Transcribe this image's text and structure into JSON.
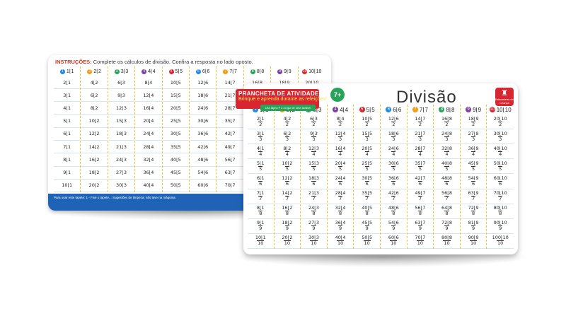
{
  "back_board": {
    "instructions_label": "INSTRUÇÕES:",
    "instructions_text": "Complete os cálculos de divisão. Confira a resposta no lado oposto.",
    "footer_text": "Para usar este tapete: 1 - Fixe o tapete... Sugestões de limpeza: não lave na máquina.",
    "footer_box_text": "LAC"
  },
  "front_board": {
    "banner_title": "PRANCHETA DE ATIVIDADES",
    "banner_subtitle": "Brinque e aprenda durante as refeições!",
    "age": "7+",
    "green_tag": "Use lápis nº 2 ou giz de cera lavável",
    "title": "Divisão",
    "logo_text": "Brincadeira de Criança"
  },
  "columns": [
    {
      "divisor": "1",
      "color": "#1e88e5"
    },
    {
      "divisor": "2",
      "color": "#f39c12"
    },
    {
      "divisor": "3",
      "color": "#2aa35a"
    },
    {
      "divisor": "4",
      "color": "#7b3fa0"
    },
    {
      "divisor": "5",
      "color": "#d7262f"
    },
    {
      "divisor": "6",
      "color": "#1e88e5"
    },
    {
      "divisor": "7",
      "color": "#f39c12"
    },
    {
      "divisor": "8",
      "color": "#2aa35a"
    },
    {
      "divisor": "9",
      "color": "#7b3fa0"
    },
    {
      "divisor": "10",
      "color": "#d7262f"
    }
  ],
  "multipliers": [
    "1",
    "2",
    "3",
    "4",
    "5",
    "6",
    "7",
    "8",
    "9",
    "10"
  ]
}
